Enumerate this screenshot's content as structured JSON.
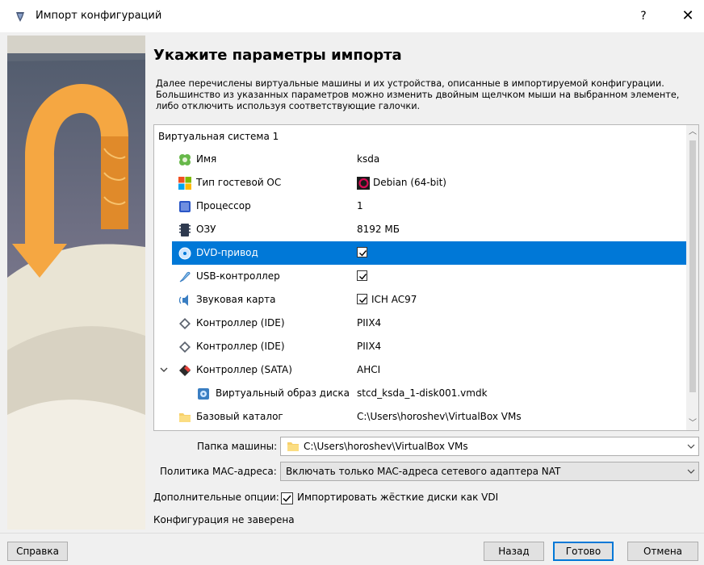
{
  "window": {
    "title": "Импорт конфигураций",
    "help_label": "?",
    "close_label": "✕"
  },
  "heading": "Укажите параметры импорта",
  "description": "Далее перечислены виртуальные машины и их устройства, описанные в импортируемой конфигурации. Большинство из указанных параметров можно изменить двойным щелчком мыши на выбранном элементе, либо отключить используя соответствующие галочки.",
  "tree": {
    "system_label": "Виртуальная система 1",
    "rows": [
      {
        "name": "Имя",
        "value": "ksda",
        "icon": "name-tag-icon"
      },
      {
        "name": "Тип гостевой ОС",
        "value": "Debian (64-bit)",
        "icon": "os-type-icon"
      },
      {
        "name": "Процессор",
        "value": "1",
        "icon": "cpu-icon"
      },
      {
        "name": "ОЗУ",
        "value": "8192 МБ",
        "icon": "ram-icon"
      },
      {
        "name": "DVD-привод",
        "value": "",
        "icon": "dvd-icon",
        "checked": true,
        "selected": true
      },
      {
        "name": "USB-контроллер",
        "value": "",
        "icon": "usb-icon",
        "checked": true
      },
      {
        "name": "Звуковая карта",
        "value": "ICH AC97",
        "icon": "sound-card-icon",
        "checked": true
      },
      {
        "name": "Контроллер (IDE)",
        "value": "PIIX4",
        "icon": "ide-controller-icon"
      },
      {
        "name": "Контроллер (IDE)",
        "value": "PIIX4",
        "icon": "ide-controller-icon"
      },
      {
        "name": "Контроллер (SATA)",
        "value": "AHCI",
        "icon": "sata-controller-icon"
      },
      {
        "name": "Виртуальный образ диска",
        "value": "stcd_ksda_1-disk001.vmdk",
        "icon": "disk-image-icon"
      },
      {
        "name": "Базовый каталог",
        "value": "C:\\Users\\horoshev\\VirtualBox VMs",
        "icon": "folder-icon"
      }
    ]
  },
  "form": {
    "machine_folder_label": "Папка машины:",
    "machine_folder_value": "C:\\Users\\horoshev\\VirtualBox VMs",
    "mac_policy_label": "Политика MAC-адреса:",
    "mac_policy_value": "Включать только MAC-адреса сетевого адаптера NAT",
    "extra_options_label": "Дополнительные опции:",
    "import_vdi_label": "Импортировать жёсткие диски как VDI",
    "import_vdi_checked": true
  },
  "status": "Конфигурация не заверена",
  "buttons": {
    "help": "Справка",
    "back": "Назад",
    "finish": "Готово",
    "cancel": "Отмена"
  },
  "colors": {
    "selection": "#0078d7",
    "arrow_orange": "#f5a742"
  }
}
